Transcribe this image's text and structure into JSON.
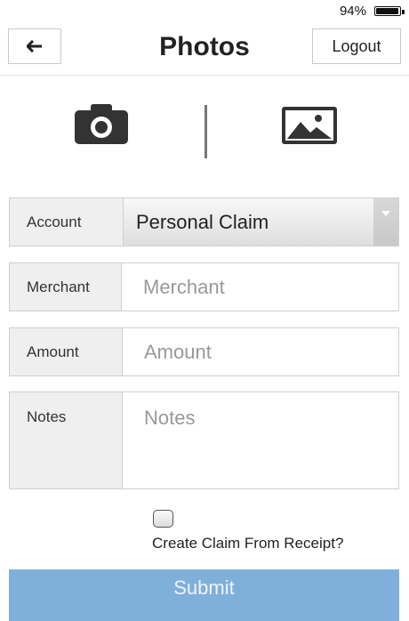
{
  "status_bar": {
    "battery_text": "94%",
    "battery_level": 0.94
  },
  "header": {
    "back_icon": "arrow-left-icon",
    "title": "Photos",
    "logout_label": "Logout"
  },
  "media": {
    "camera_icon": "camera-icon",
    "gallery_icon": "image-icon"
  },
  "form": {
    "account": {
      "label": "Account",
      "value": "Personal Claim"
    },
    "merchant": {
      "label": "Merchant",
      "placeholder": "Merchant"
    },
    "amount": {
      "label": "Amount",
      "placeholder": "Amount"
    },
    "notes": {
      "label": "Notes",
      "placeholder": "Notes"
    },
    "create_claim": {
      "label": "Create Claim From Receipt?",
      "checked": false
    },
    "submit_label": "Submit"
  },
  "colors": {
    "submit_bg": "#7fafdb",
    "label_bg": "#efefef"
  }
}
